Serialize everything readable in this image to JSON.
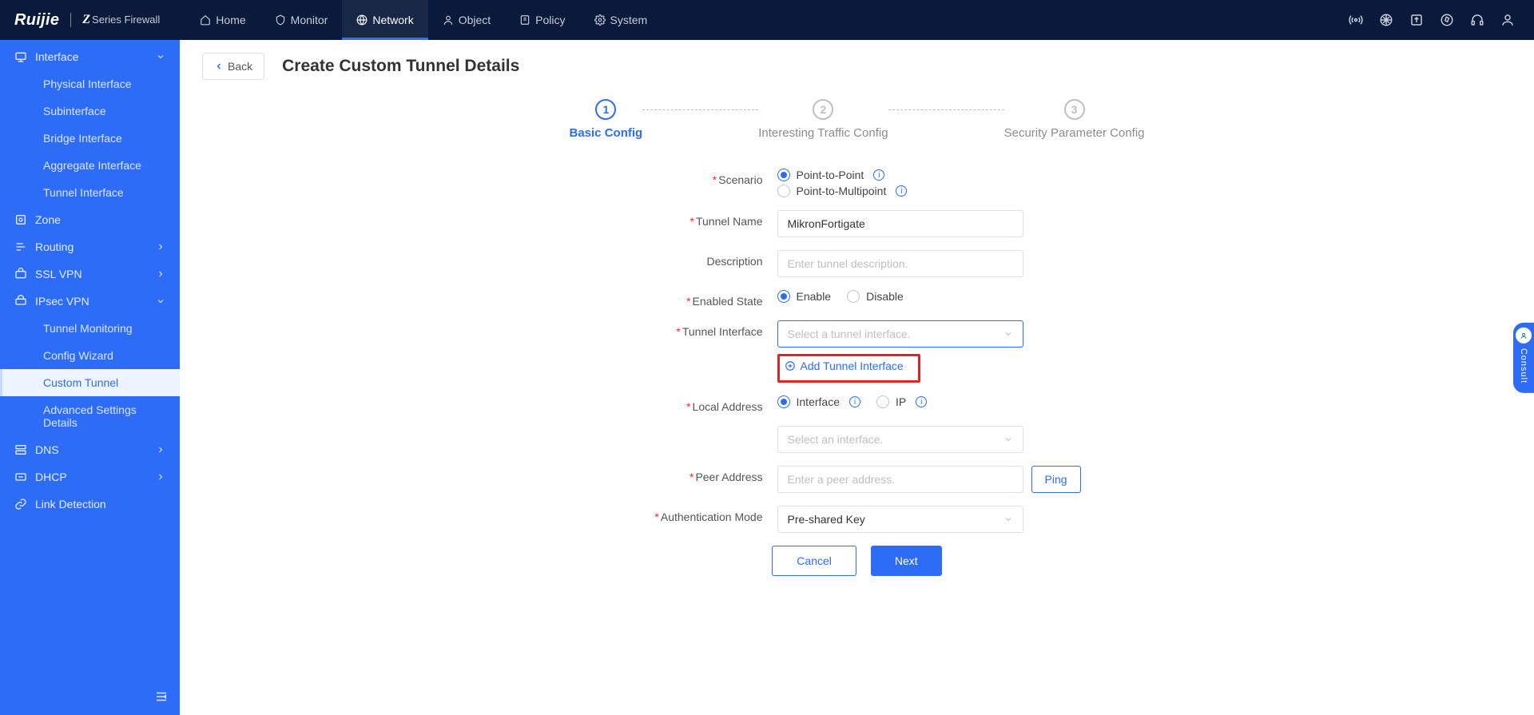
{
  "brand": {
    "logo": "Ruijie",
    "series": "Series Firewall",
    "z": "Z"
  },
  "topnav": [
    {
      "label": "Home"
    },
    {
      "label": "Monitor"
    },
    {
      "label": "Network",
      "active": true
    },
    {
      "label": "Object"
    },
    {
      "label": "Policy"
    },
    {
      "label": "System"
    }
  ],
  "sidebar": {
    "groups": [
      {
        "label": "Interface",
        "icon": "interface",
        "expanded": true,
        "children": [
          {
            "label": "Physical Interface"
          },
          {
            "label": "Subinterface"
          },
          {
            "label": "Bridge Interface"
          },
          {
            "label": "Aggregate Interface"
          },
          {
            "label": "Tunnel Interface"
          }
        ]
      },
      {
        "label": "Zone",
        "icon": "zone"
      },
      {
        "label": "Routing",
        "icon": "routing",
        "arrow": true
      },
      {
        "label": "SSL VPN",
        "icon": "sslvpn",
        "arrow": true
      },
      {
        "label": "IPsec VPN",
        "icon": "ipsec",
        "expanded": true,
        "arrow": true,
        "children": [
          {
            "label": "Tunnel Monitoring"
          },
          {
            "label": "Config Wizard"
          },
          {
            "label": "Custom Tunnel",
            "selected": true
          },
          {
            "label": "Advanced Settings Details"
          }
        ]
      },
      {
        "label": "DNS",
        "icon": "dns",
        "arrow": true
      },
      {
        "label": "DHCP",
        "icon": "dhcp",
        "arrow": true
      },
      {
        "label": "Link Detection",
        "icon": "link"
      }
    ]
  },
  "page": {
    "back": "Back",
    "title": "Create Custom Tunnel Details"
  },
  "steps": [
    {
      "n": "1",
      "label": "Basic Config",
      "active": true
    },
    {
      "n": "2",
      "label": "Interesting Traffic Config"
    },
    {
      "n": "3",
      "label": "Security Parameter Config"
    }
  ],
  "form": {
    "scenario": {
      "label": "Scenario",
      "opt1": "Point-to-Point",
      "opt2": "Point-to-Multipoint",
      "value": "p2p"
    },
    "tunnel_name": {
      "label": "Tunnel Name",
      "value": "MikronFortigate"
    },
    "description": {
      "label": "Description",
      "placeholder": "Enter tunnel description.",
      "value": ""
    },
    "enabled": {
      "label": "Enabled State",
      "opt1": "Enable",
      "opt2": "Disable",
      "value": "enable"
    },
    "tunnel_if": {
      "label": "Tunnel Interface",
      "placeholder": "Select a tunnel interface.",
      "selected": ""
    },
    "add_tunnel_if": "Add Tunnel Interface",
    "local_addr": {
      "label": "Local Address",
      "opt1": "Interface",
      "opt2": "IP",
      "value": "interface",
      "if_placeholder": "Select an interface.",
      "if_selected": ""
    },
    "peer_addr": {
      "label": "Peer Address",
      "placeholder": "Enter a peer address.",
      "value": "",
      "ping": "Ping"
    },
    "auth_mode": {
      "label": "Authentication Mode",
      "selected": "Pre-shared Key"
    },
    "cancel": "Cancel",
    "next": "Next"
  },
  "consult": "Consult"
}
